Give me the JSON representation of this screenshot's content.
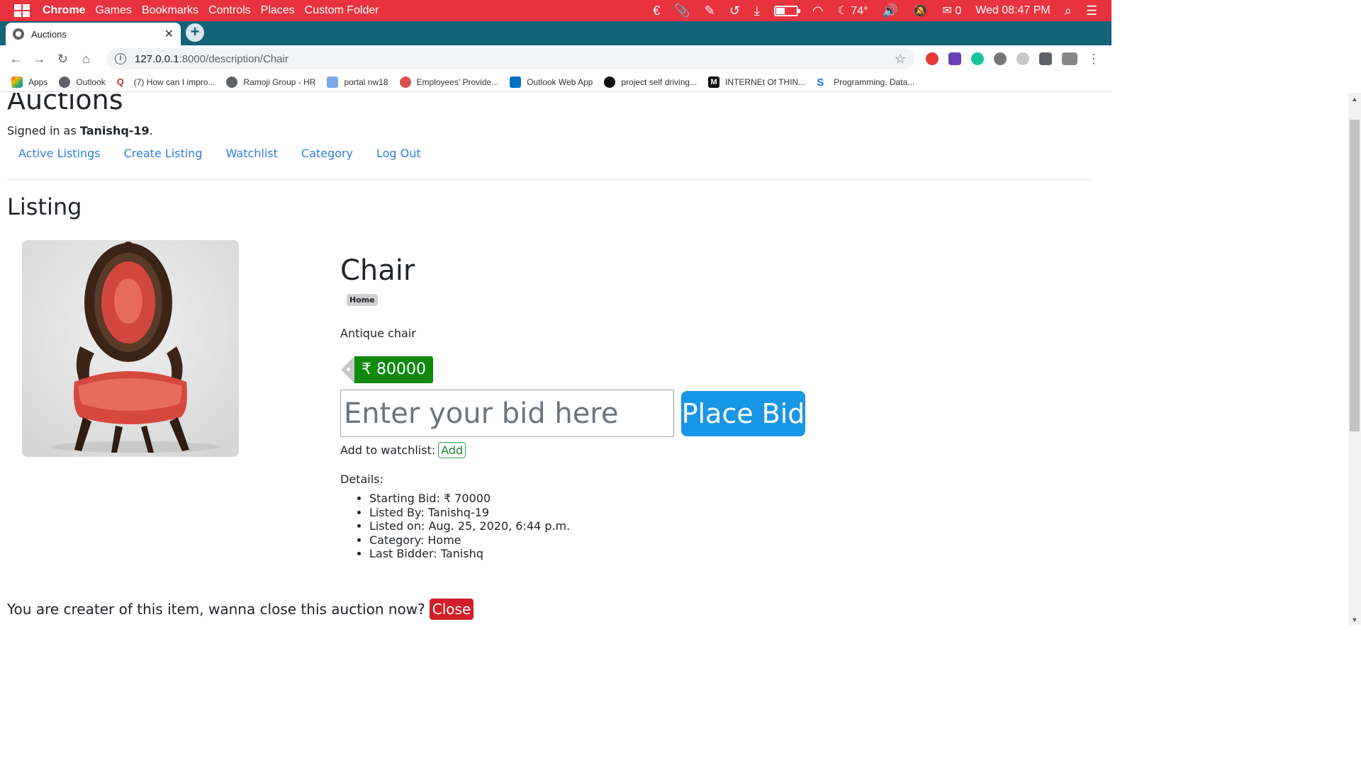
{
  "os_bar": {
    "app_name": "Chrome",
    "menus": [
      "Games",
      "Bookmarks",
      "Controls",
      "Places",
      "Custom Folder"
    ],
    "weather": "74°",
    "mail_count": "0",
    "clock": "Wed 08:47 PM"
  },
  "browser": {
    "tab_title": "Auctions",
    "url_host": "127.0.0.1",
    "url_path": ":8000/description/Chair"
  },
  "bookmarks": [
    {
      "label": "Apps",
      "icon": "apps-grid-icon"
    },
    {
      "label": "Outlook",
      "icon": "globe-icon"
    },
    {
      "label": "(7) How can I impro...",
      "icon": "quora-icon"
    },
    {
      "label": "Ramoji Group - HR",
      "icon": "globe-icon"
    },
    {
      "label": "portal nw18",
      "icon": "portal-icon"
    },
    {
      "label": "Employees' Provide...",
      "icon": "epf-icon"
    },
    {
      "label": "Outlook Web App",
      "icon": "outlook-icon"
    },
    {
      "label": "project self driving...",
      "icon": "github-icon"
    },
    {
      "label": "INTERNEt Of THIN...",
      "icon": "medium-icon"
    },
    {
      "label": "Programming, Data...",
      "icon": "s-logo-icon"
    }
  ],
  "page": {
    "site_title": "Auctions",
    "signed_in_prefix": "Signed in as ",
    "username": "Tanishq-19",
    "signed_in_suffix": ".",
    "nav": [
      "Active Listings",
      "Create Listing",
      "Watchlist",
      "Category",
      "Log Out"
    ],
    "section_heading": "Listing",
    "item": {
      "title": "Chair",
      "category_badge": "Home",
      "description": "Antique chair",
      "price": "₹ 80000",
      "bid_placeholder": "Enter your bid here",
      "bid_button": "Place Bid",
      "watchlist_label": "Add to watchlist:",
      "watchlist_button": "Add",
      "details_label": "Details:",
      "details": [
        "Starting Bid: ₹ 70000",
        "Listed By: Tanishq-19",
        "Listed on: Aug. 25, 2020, 6:44 p.m.",
        "Category: Home",
        "Last Bidder: Tanishq"
      ]
    },
    "close_prompt": "You are creater of this item, wanna close this auction now?",
    "close_button": "Close"
  },
  "colors": {
    "os_bar": "#e8333e",
    "tab_strip": "#15637a",
    "price_badge": "#0f8a0f",
    "bid_button": "#1896e6",
    "close_button": "#d11f28",
    "link": "#2e7dd7"
  }
}
